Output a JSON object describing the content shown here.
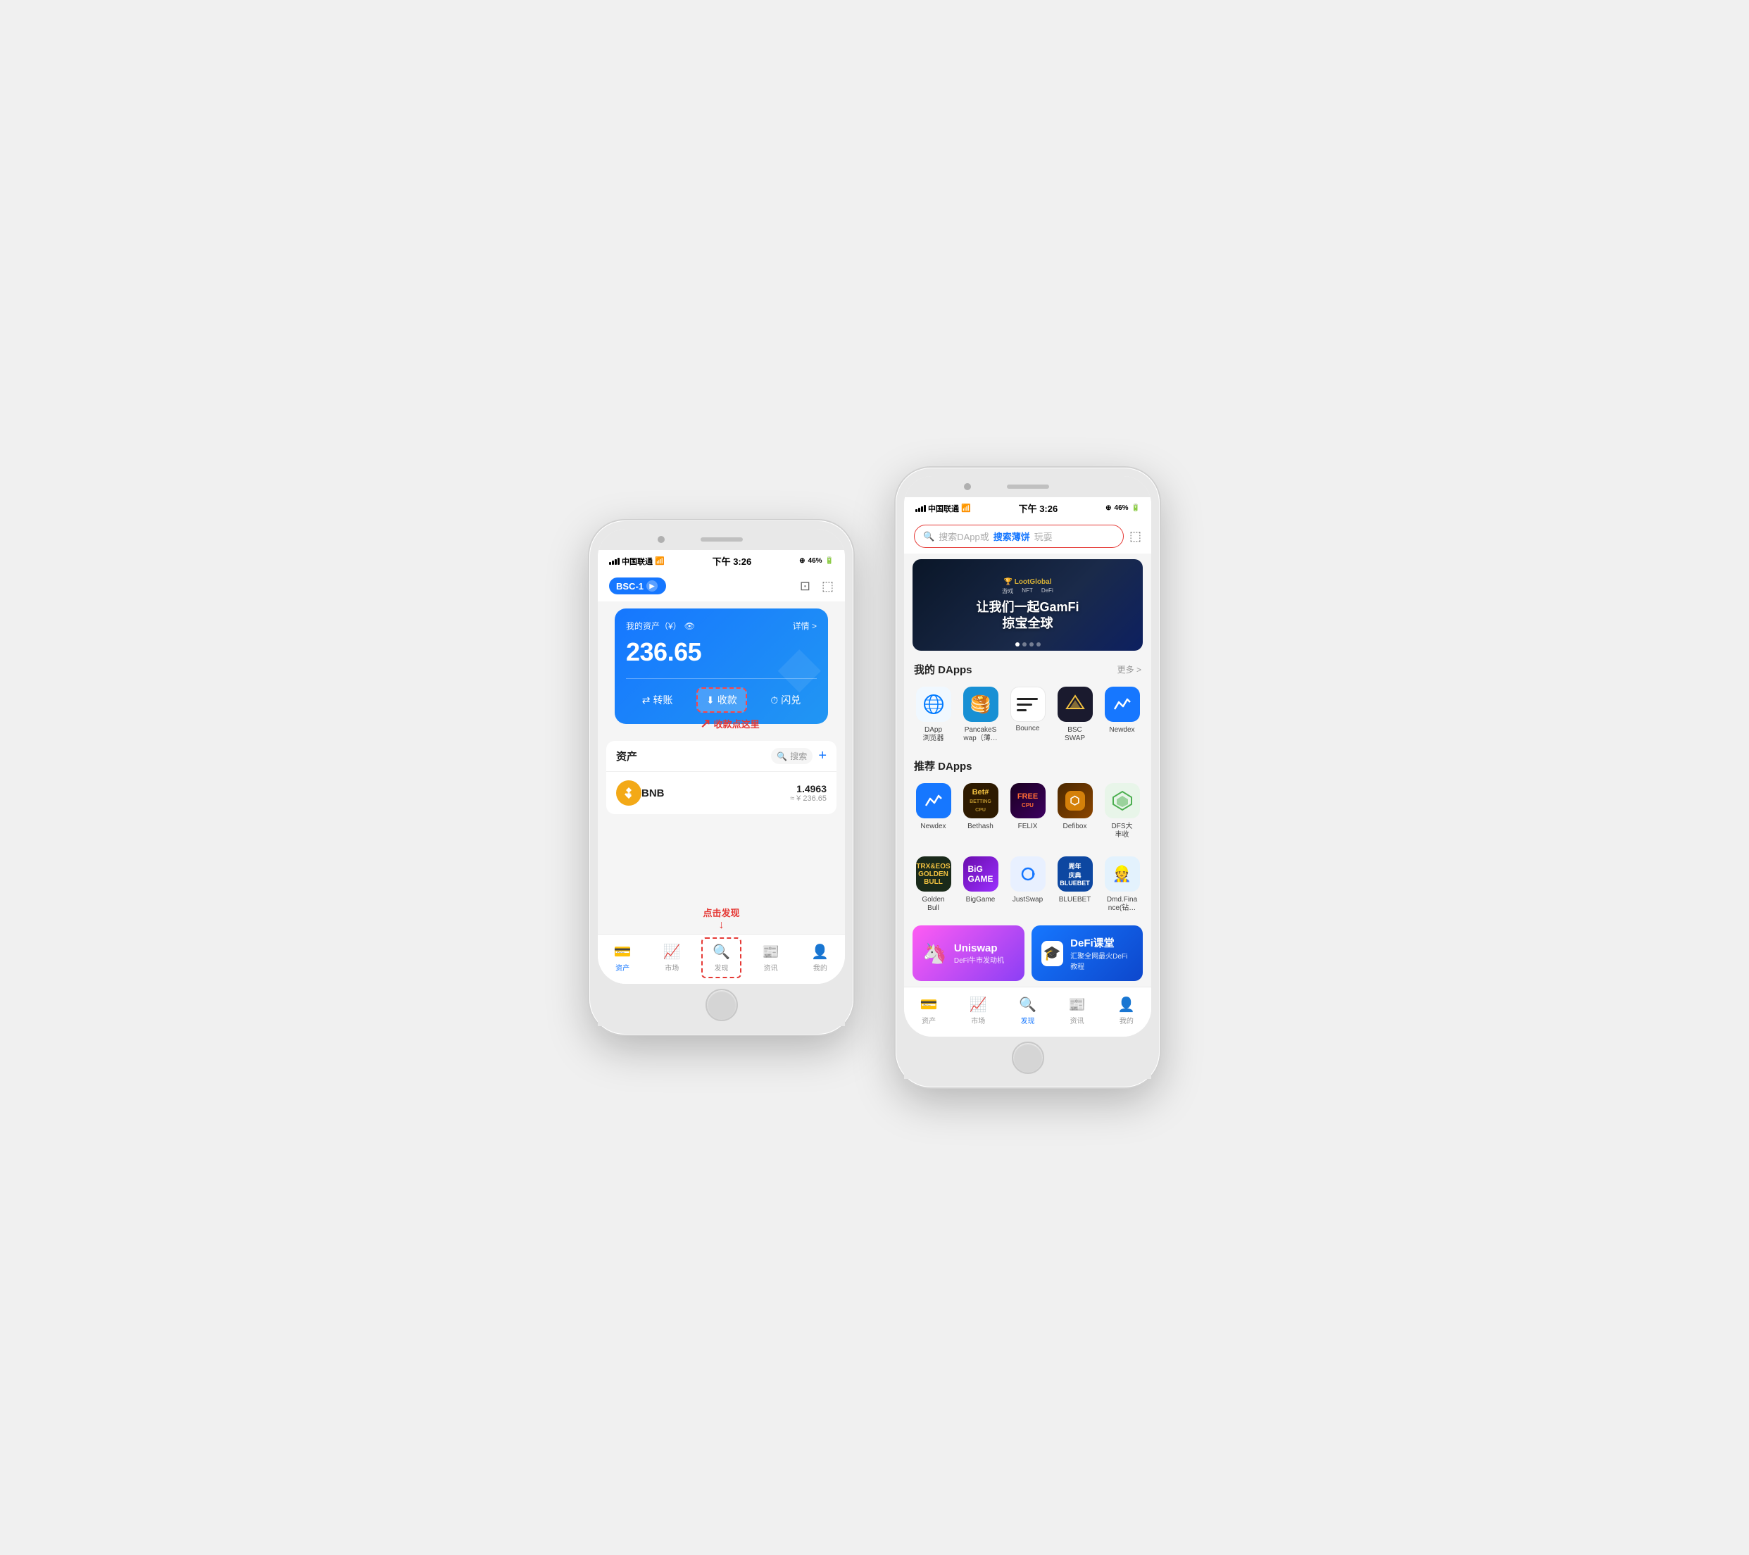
{
  "page": {
    "background": "#f0f0f0"
  },
  "left_phone": {
    "status_bar": {
      "carrier": "中国联通",
      "time": "下午 3:26",
      "battery": "46%"
    },
    "header": {
      "network": "BSC-1"
    },
    "asset_card": {
      "label": "我的资产（¥）",
      "detail": "详情 >",
      "amount": "236.65",
      "actions": {
        "transfer": "转账",
        "receive": "收款",
        "flash": "闪兑"
      }
    },
    "annotation_receive": "收款点这里",
    "assets_section": {
      "title": "资产",
      "search_placeholder": "搜索",
      "token": {
        "name": "BNB",
        "amount": "1.4963",
        "cny": "≈ ¥ 236.65"
      }
    },
    "tabs": [
      {
        "label": "资产",
        "icon": "wallet",
        "active": true
      },
      {
        "label": "市场",
        "icon": "chart"
      },
      {
        "label": "发现",
        "icon": "compass",
        "annotated": true
      },
      {
        "label": "资讯",
        "icon": "news"
      },
      {
        "label": "我的",
        "icon": "user"
      }
    ],
    "annotation_discover": "点击发现"
  },
  "right_phone": {
    "status_bar": {
      "carrier": "中国联通",
      "time": "下午 3:26",
      "battery": "46%"
    },
    "search": {
      "placeholder": "搜索DApp或",
      "highlight": "搜索薄饼",
      "placeholder2": "玩耍"
    },
    "banner": {
      "logo": "🏆 LootGlobal",
      "tags": [
        "游戏",
        "NFT",
        "DeFi"
      ],
      "text_line1": "让我们一起GamFi",
      "text_line2": "掠宝全球"
    },
    "my_dapps": {
      "title": "我的 DApps",
      "more": "更多 >",
      "items": [
        {
          "label": "DApp\n浏览器",
          "icon_type": "browser"
        },
        {
          "label": "PancakeS\nwap（薄…",
          "icon_type": "pancake"
        },
        {
          "label": "Bounce",
          "icon_type": "bounce"
        },
        {
          "label": "BSC\nSWAP",
          "icon_type": "bscswap"
        },
        {
          "label": "Newdex",
          "icon_type": "newdex"
        }
      ]
    },
    "recommended_dapps": {
      "title": "推荐 DApps",
      "row1": [
        {
          "label": "Newdex",
          "icon_type": "newdex2"
        },
        {
          "label": "Bethash",
          "icon_type": "bethash"
        },
        {
          "label": "FELIX",
          "icon_type": "felix"
        },
        {
          "label": "Defibox",
          "icon_type": "defibox"
        },
        {
          "label": "DFS大\n丰收",
          "icon_type": "dfs"
        }
      ],
      "row2": [
        {
          "label": "Golden\nBull",
          "icon_type": "goldenbull"
        },
        {
          "label": "BigGame",
          "icon_type": "biggame"
        },
        {
          "label": "JustSwap",
          "icon_type": "justswap"
        },
        {
          "label": "BLUEBET",
          "icon_type": "bluebet"
        },
        {
          "label": "Dmd.Fina\nnce(钻…",
          "icon_type": "dmd"
        }
      ]
    },
    "promos": [
      {
        "type": "uniswap",
        "title": "Uniswap",
        "subtitle": "DeFi牛市发动机",
        "icon": "🦄"
      },
      {
        "type": "defi",
        "title": "DeFi课堂",
        "subtitle": "汇聚全网最火DeFi教程",
        "icon": "🎓"
      }
    ],
    "tabs": [
      {
        "label": "资产",
        "icon": "wallet"
      },
      {
        "label": "市场",
        "icon": "chart"
      },
      {
        "label": "发现",
        "icon": "compass",
        "active": true
      },
      {
        "label": "资讯",
        "icon": "news"
      },
      {
        "label": "我的",
        "icon": "user"
      }
    ]
  }
}
